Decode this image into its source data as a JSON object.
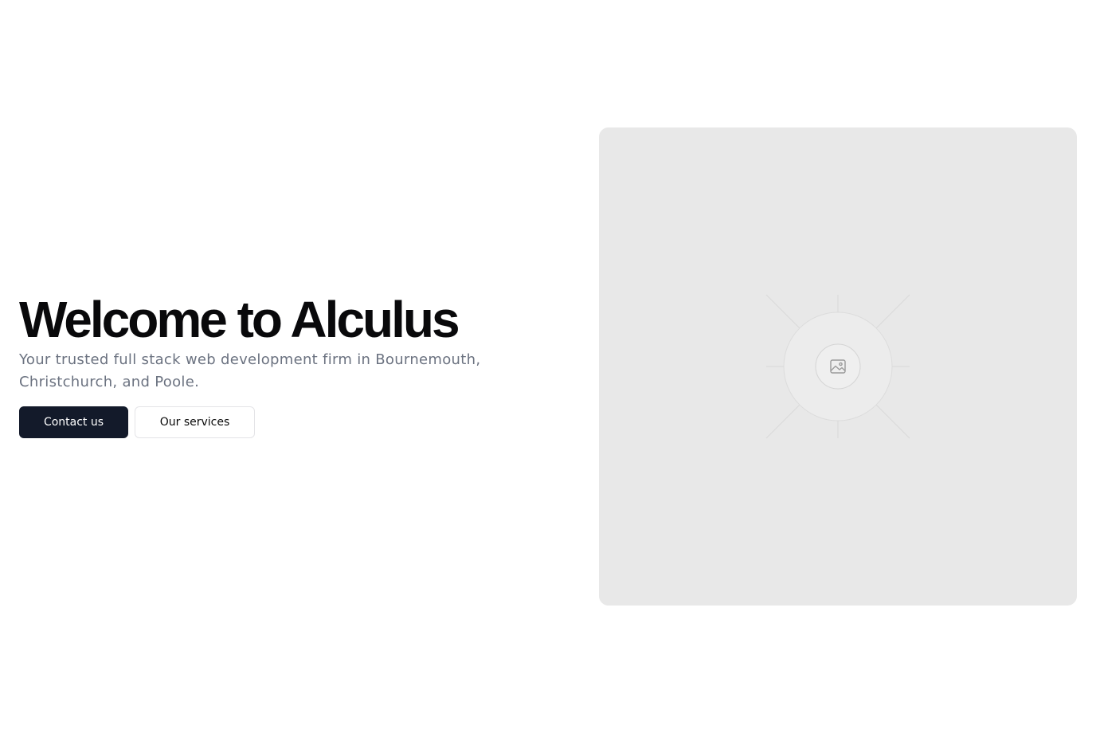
{
  "hero": {
    "title": "Welcome to Alculus",
    "subtitle": "Your trusted full stack web development firm in Bournemouth, Christchurch, and Poole.",
    "primary_button_label": "Contact us",
    "secondary_button_label": "Our services",
    "image_icon": "image-placeholder-icon"
  },
  "colors": {
    "page_background": "#ffffff",
    "title": "#09090b",
    "subtitle": "#6b7280",
    "primary_button_bg": "#131a2a",
    "primary_button_text": "#ffffff",
    "secondary_button_border": "#e4e4e7",
    "image_placeholder_bg": "#e8e8e8"
  }
}
